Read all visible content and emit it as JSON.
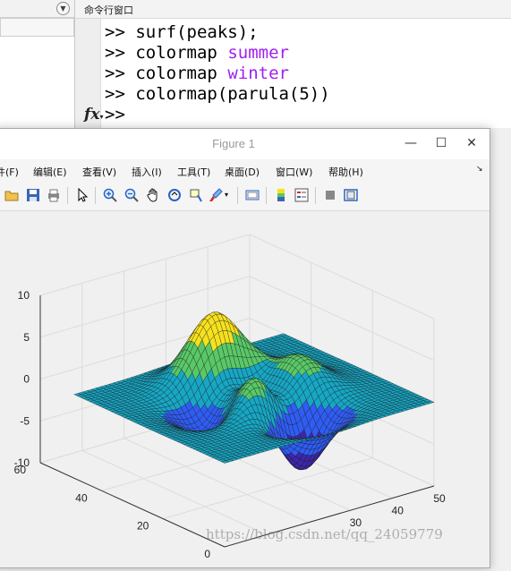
{
  "command_window": {
    "title": "命令行窗口",
    "lines": [
      {
        "prompt": ">>",
        "cmd": "surf(peaks);",
        "arg": ""
      },
      {
        "prompt": ">>",
        "cmd": "colormap",
        "arg": "summer"
      },
      {
        "prompt": ">>",
        "cmd": "colormap",
        "arg": "winter"
      },
      {
        "prompt": ">>",
        "cmd": "colormap(parula(5))",
        "arg": ""
      }
    ],
    "fx_label": "fx",
    "current_prompt": ">>"
  },
  "figure": {
    "title": "Figure 1",
    "menu": [
      "件(F)",
      "编辑(E)",
      "查看(V)",
      "插入(I)",
      "工具(T)",
      "桌面(D)",
      "窗口(W)",
      "帮助(H)"
    ],
    "toolbar_icons": [
      "open-icon",
      "save-icon",
      "print-icon",
      "pointer-icon",
      "zoom-in-icon",
      "zoom-out-icon",
      "pan-icon",
      "rotate-icon",
      "data-cursor-icon",
      "brush-icon",
      "link-icon",
      "colorbar-icon",
      "legend-icon",
      "hide-plot-tools-icon",
      "show-plot-tools-icon"
    ]
  },
  "chart_data": {
    "type": "surface",
    "function": "peaks",
    "colormap": "parula(5)",
    "colors": [
      "#3e26a8",
      "#2f5cf4",
      "#16a7c5",
      "#59c867",
      "#f6e11f"
    ],
    "z_ticks": [
      "-10",
      "-5",
      "0",
      "5",
      "10"
    ],
    "y_ticks": [
      "0",
      "20",
      "40",
      "60"
    ],
    "x_ticks": [
      "30",
      "40",
      "50"
    ],
    "xlim": [
      0,
      50
    ],
    "ylim": [
      0,
      60
    ],
    "zlim": [
      -10,
      10
    ],
    "grid": true
  },
  "watermark": "https://blog.csdn.net/qq_24059779"
}
